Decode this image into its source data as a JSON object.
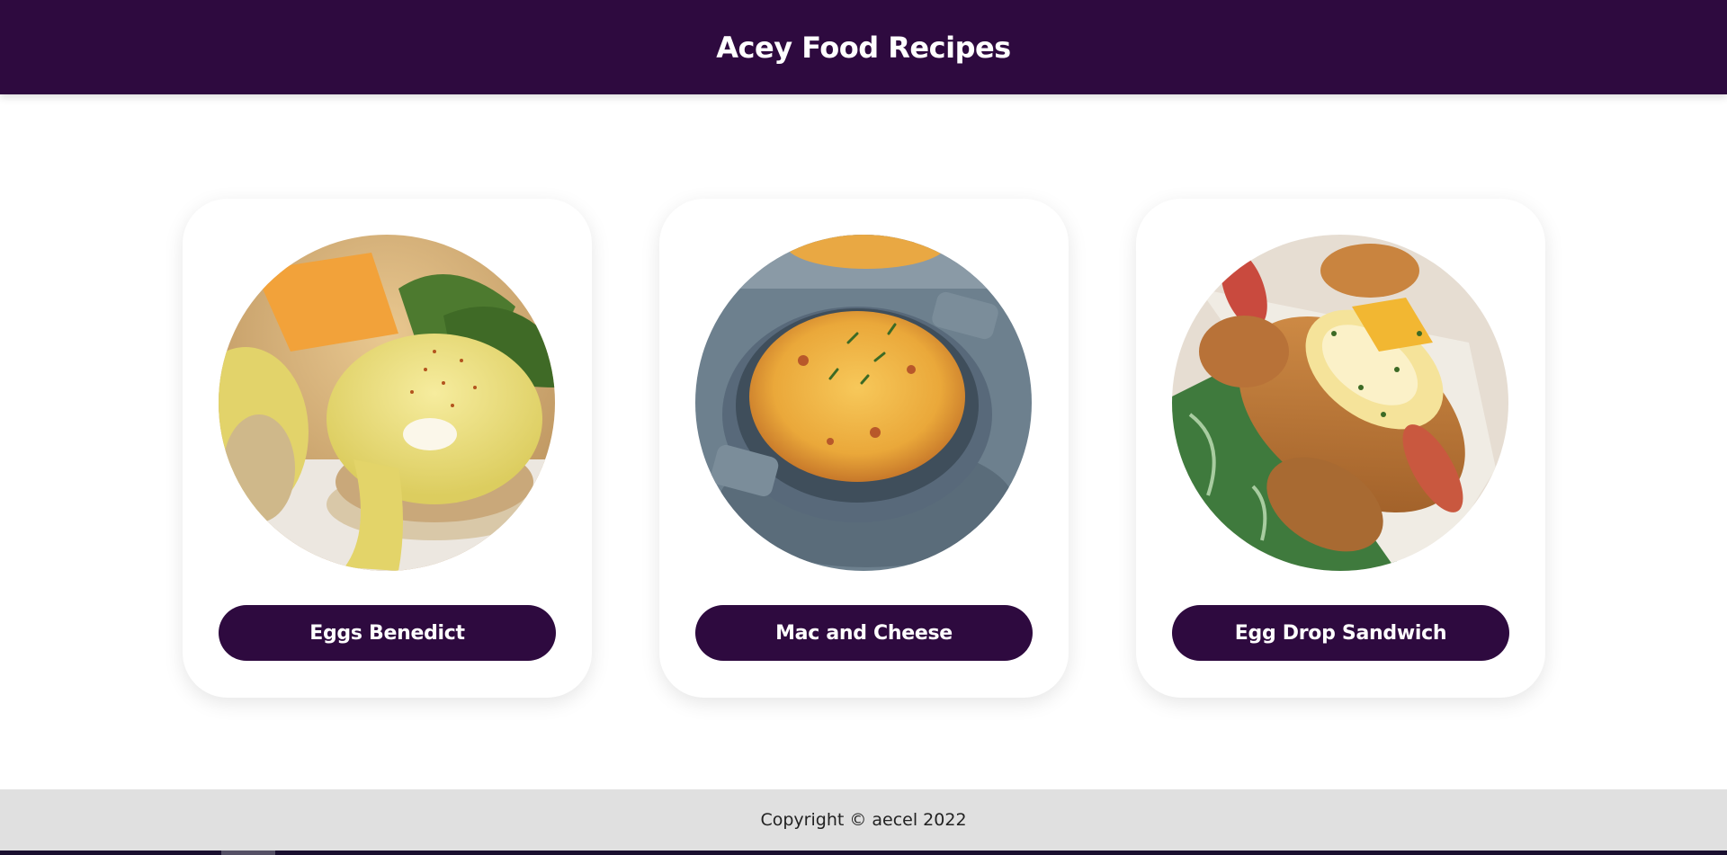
{
  "header": {
    "title": "Acey Food Recipes"
  },
  "recipes": [
    {
      "label": "Eggs Benedict",
      "image_icon": "eggs-benedict-photo"
    },
    {
      "label": "Mac and Cheese",
      "image_icon": "mac-and-cheese-photo"
    },
    {
      "label": "Egg Drop Sandwich",
      "image_icon": "egg-drop-sandwich-photo"
    }
  ],
  "footer": {
    "copyright": "Copyright © aecel 2022"
  },
  "colors": {
    "brand": "#2e0a3f",
    "footer_bg": "#e0e0e0",
    "page_bg": "#ffffff"
  }
}
